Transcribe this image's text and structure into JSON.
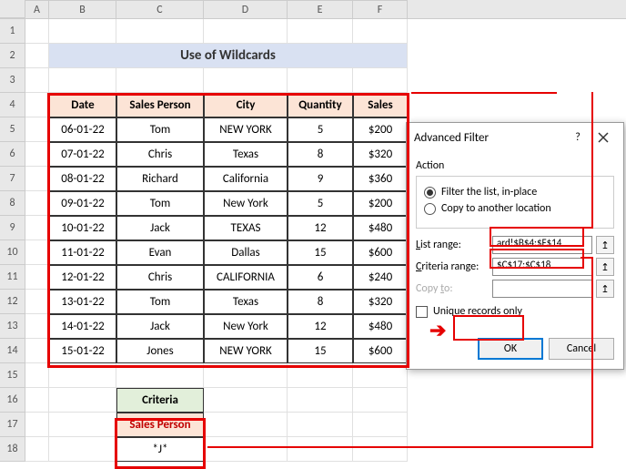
{
  "columns": [
    "A",
    "B",
    "C",
    "D",
    "E",
    "F"
  ],
  "rows": [
    "1",
    "2",
    "3",
    "4",
    "5",
    "6",
    "7",
    "8",
    "9",
    "10",
    "11",
    "12",
    "13",
    "14",
    "15",
    "16",
    "17",
    "18"
  ],
  "title": "Use of Wildcards",
  "headers": {
    "date": "Date",
    "person": "Sales Person",
    "city": "City",
    "qty": "Quantity",
    "sales": "Sales"
  },
  "data": [
    {
      "date": "06-01-22",
      "person": "Tom",
      "city": "NEW YORK",
      "qty": "5",
      "sales": "$200"
    },
    {
      "date": "07-01-22",
      "person": "Chris",
      "city": "Texas",
      "qty": "8",
      "sales": "$320"
    },
    {
      "date": "08-01-22",
      "person": "Richard",
      "city": "California",
      "qty": "9",
      "sales": "$360"
    },
    {
      "date": "09-01-22",
      "person": "Tom",
      "city": "New York",
      "qty": "5",
      "sales": "$200"
    },
    {
      "date": "10-01-22",
      "person": "Jack",
      "city": "TEXAS",
      "qty": "12",
      "sales": "$480"
    },
    {
      "date": "11-01-22",
      "person": "Evan",
      "city": "Dallas",
      "qty": "15",
      "sales": "$600"
    },
    {
      "date": "12-01-22",
      "person": "Chris",
      "city": "CALIFORNIA",
      "qty": "6",
      "sales": "$240"
    },
    {
      "date": "13-01-22",
      "person": "Tom",
      "city": "Texas",
      "qty": "8",
      "sales": "$320"
    },
    {
      "date": "14-01-22",
      "person": "Jack",
      "city": "New York",
      "qty": "12",
      "sales": "$480"
    },
    {
      "date": "15-01-22",
      "person": "Jones",
      "city": "NEW YORK",
      "qty": "15",
      "sales": "$600"
    }
  ],
  "criteria": {
    "label": "Criteria",
    "header": "Sales Person",
    "value": "*J*"
  },
  "dialog": {
    "title": "Advanced Filter",
    "action_label": "Action",
    "radio1": "Filter the list, in-place",
    "radio2": "Copy to another location",
    "list_label": "List range:",
    "list_value": "ard!$B$4:$F$14",
    "crit_label": "Criteria range:",
    "crit_value": "$C$17:$C$18",
    "copy_label": "Copy to:",
    "copy_value": "",
    "unique": "Unique records only",
    "ok": "OK",
    "cancel": "Cancel",
    "help": "?"
  }
}
